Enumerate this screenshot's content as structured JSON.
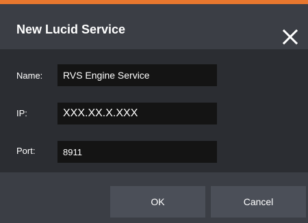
{
  "dialog": {
    "title": "New Lucid Service",
    "close_icon": "close-icon",
    "accent_color": "#e8772e"
  },
  "form": {
    "name_label": "Name:",
    "name_value": "RVS Engine Service",
    "ip_label": "IP:",
    "ip_value": "XXX.XX.X.XXX",
    "port_label": "Port:",
    "port_value": "8911"
  },
  "footer": {
    "ok_label": "OK",
    "cancel_label": "Cancel"
  }
}
